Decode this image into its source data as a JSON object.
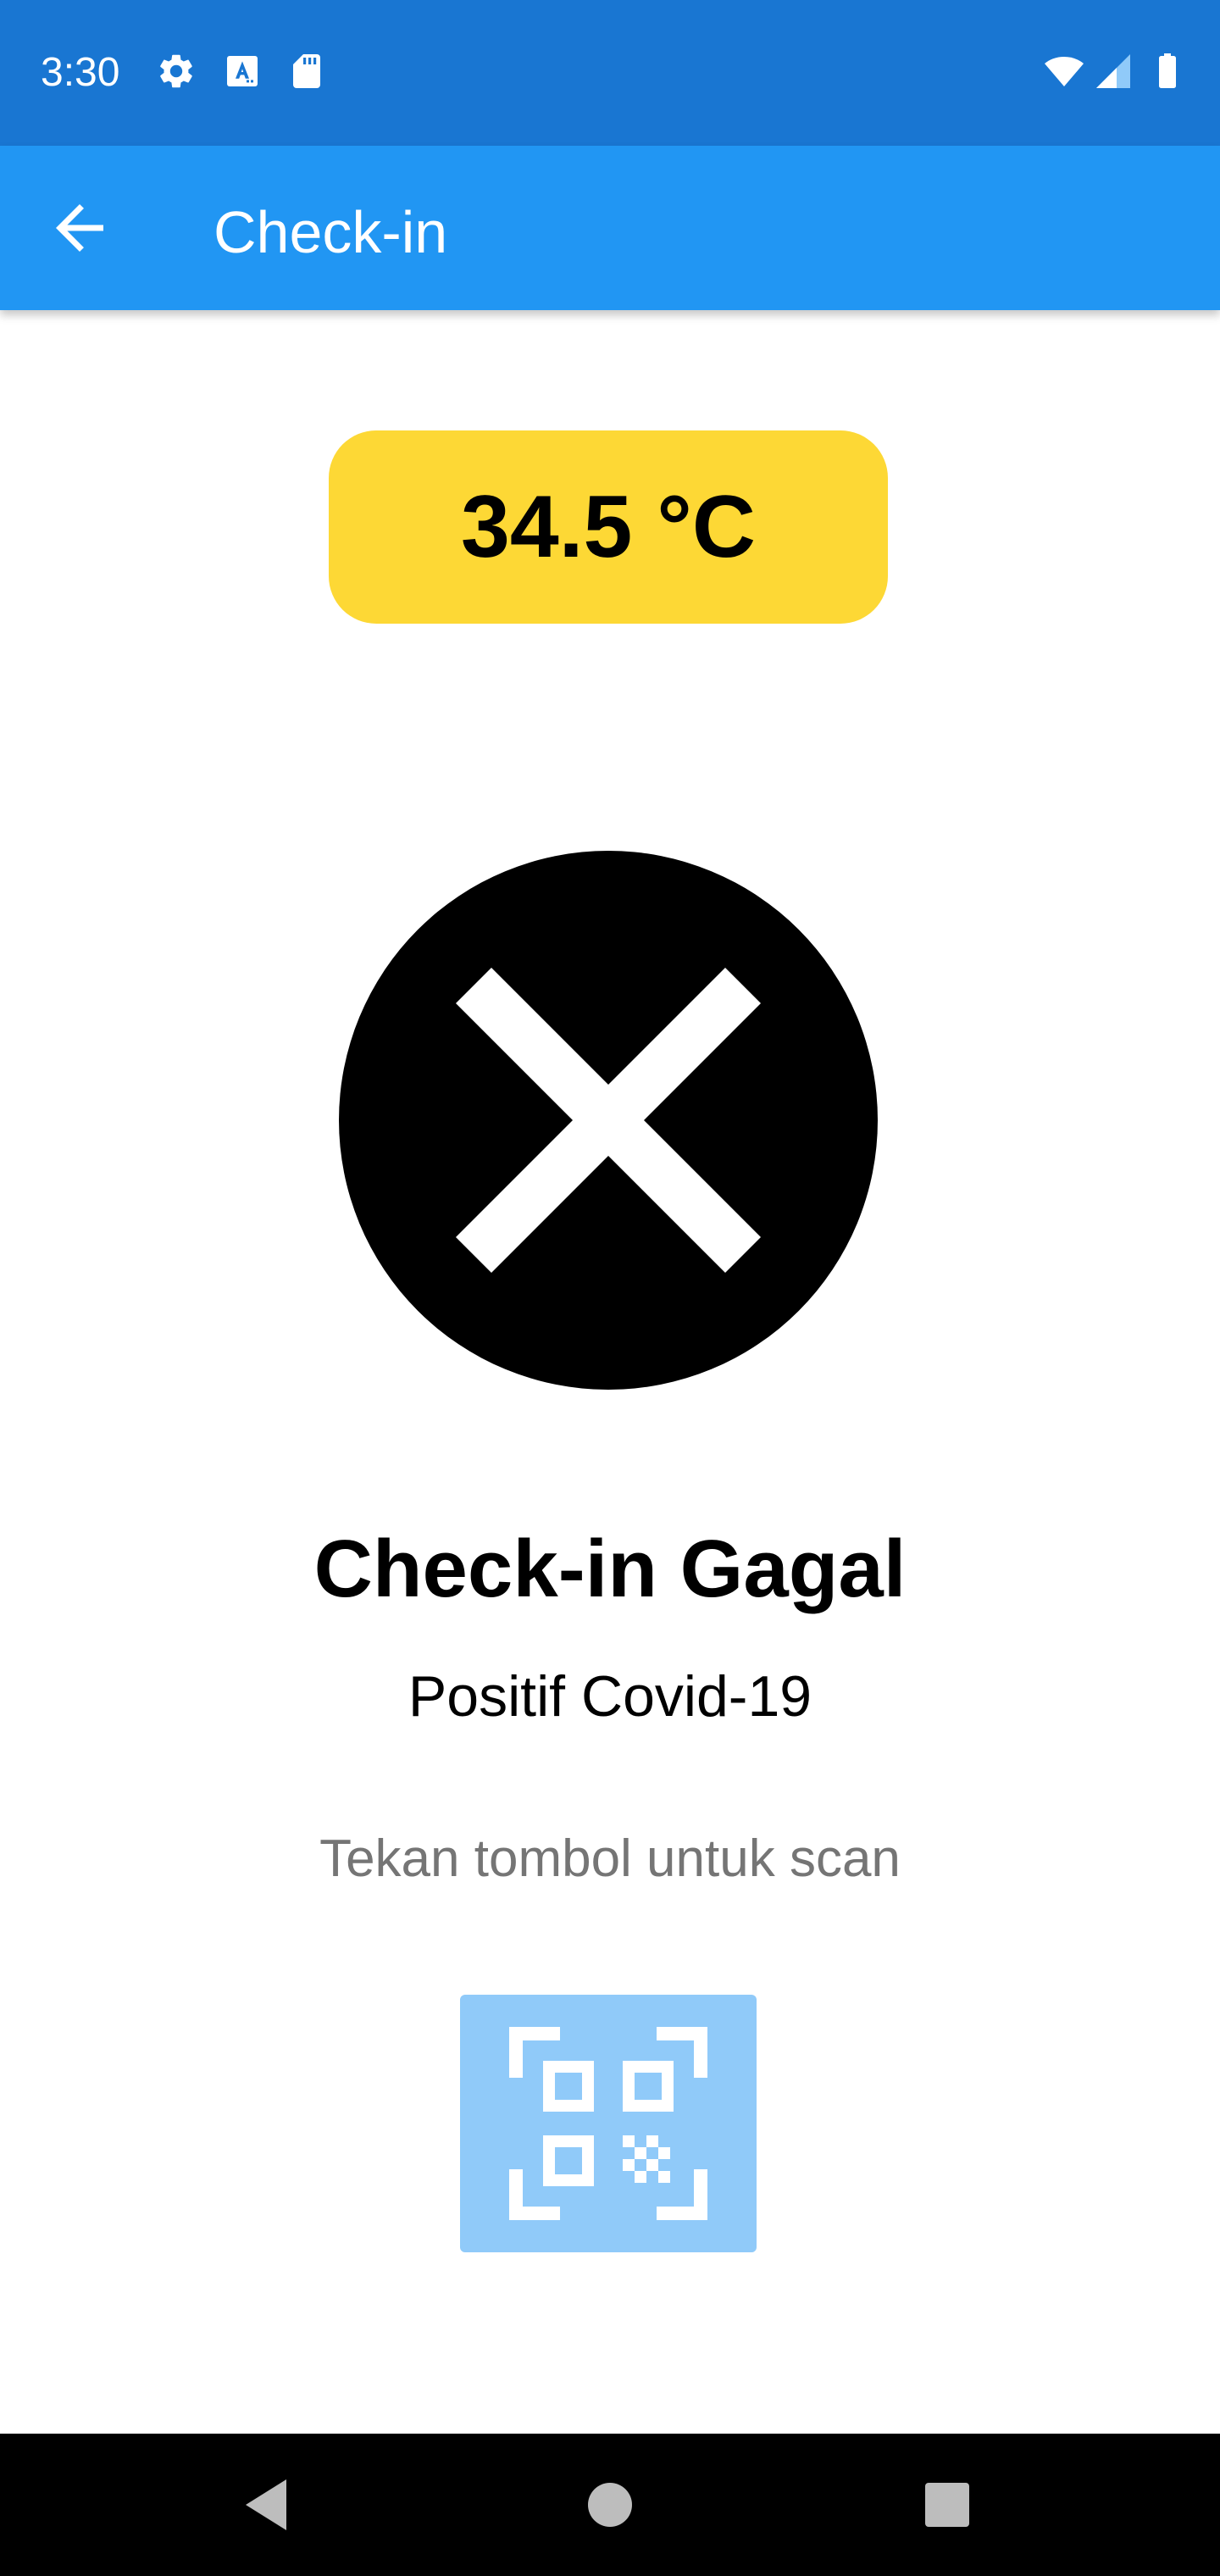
{
  "status_bar": {
    "time": "3:30",
    "icons_left": [
      "gear-icon",
      "text-a-icon",
      "sd-card-icon"
    ],
    "icons_right": [
      "wifi-icon",
      "cell-signal-icon",
      "battery-icon"
    ],
    "background_color": "#1976D2"
  },
  "app_bar": {
    "title": "Check-in",
    "back_icon": "arrow-back-icon",
    "background_color": "#2196F3"
  },
  "temperature": {
    "value": "34.5 °C",
    "badge_color": "#FDD835"
  },
  "result": {
    "icon": "cancel-icon",
    "title": "Check-in Gagal",
    "subtitle": "Positif Covid-19"
  },
  "scan": {
    "hint": "Tekan tombol untuk scan",
    "button_icon": "qr-code-scan-icon",
    "button_color": "#90CAF9"
  },
  "nav_bar": {
    "buttons": [
      "back-triangle-icon",
      "home-circle-icon",
      "recents-square-icon"
    ]
  }
}
